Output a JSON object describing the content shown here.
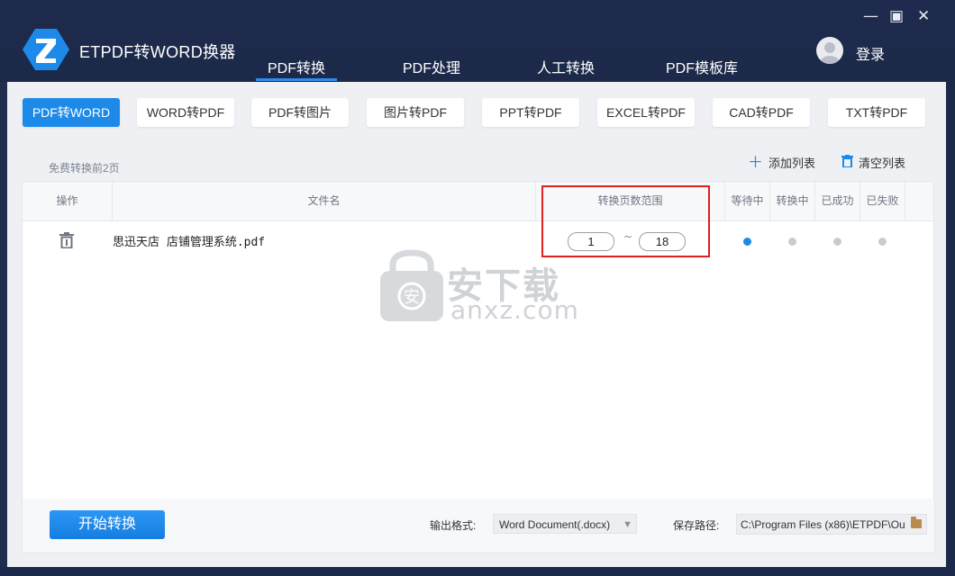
{
  "app": {
    "title": "ETPDF转WORD换器"
  },
  "window_controls": {
    "minimize": "—",
    "maximize": "▣",
    "close": "✕"
  },
  "header": {
    "tabs": [
      {
        "label": "PDF转换",
        "active": true
      },
      {
        "label": "PDF处理",
        "active": false
      },
      {
        "label": "人工转换",
        "active": false
      },
      {
        "label": "PDF模板库",
        "active": false
      }
    ],
    "login_label": "登录"
  },
  "subtabs": [
    {
      "label": "PDF转WORD",
      "active": true
    },
    {
      "label": "WORD转PDF",
      "active": false
    },
    {
      "label": "PDF转图片",
      "active": false
    },
    {
      "label": "图片转PDF",
      "active": false
    },
    {
      "label": "PPT转PDF",
      "active": false
    },
    {
      "label": "EXCEL转PDF",
      "active": false
    },
    {
      "label": "CAD转PDF",
      "active": false
    },
    {
      "label": "TXT转PDF",
      "active": false
    }
  ],
  "list": {
    "free_hint": "免费转换前2页",
    "add_label": "添加列表",
    "clear_label": "清空列表",
    "columns": {
      "action": "操作",
      "filename": "文件名",
      "page_range": "转换页数范围",
      "waiting": "等待中",
      "converting": "转换中",
      "success": "已成功",
      "failed": "已失败"
    },
    "rows": [
      {
        "filename": "思迅天店 店铺管理系统.pdf",
        "page_from": "1",
        "page_to": "18",
        "status": "waiting"
      }
    ],
    "range_sep": "~"
  },
  "watermark": {
    "text": "安下载",
    "sub": "anxz.com"
  },
  "footer": {
    "start_label": "开始转换",
    "format_label": "输出格式:",
    "format_value": "Word Document(.docx)",
    "path_label": "保存路径:",
    "path_value": "C:\\Program Files (x86)\\ETPDF\\Ou"
  },
  "colors": {
    "accent": "#1d8ae9",
    "header_bg": "#1e2b4e",
    "highlight": "#e01f1f"
  }
}
